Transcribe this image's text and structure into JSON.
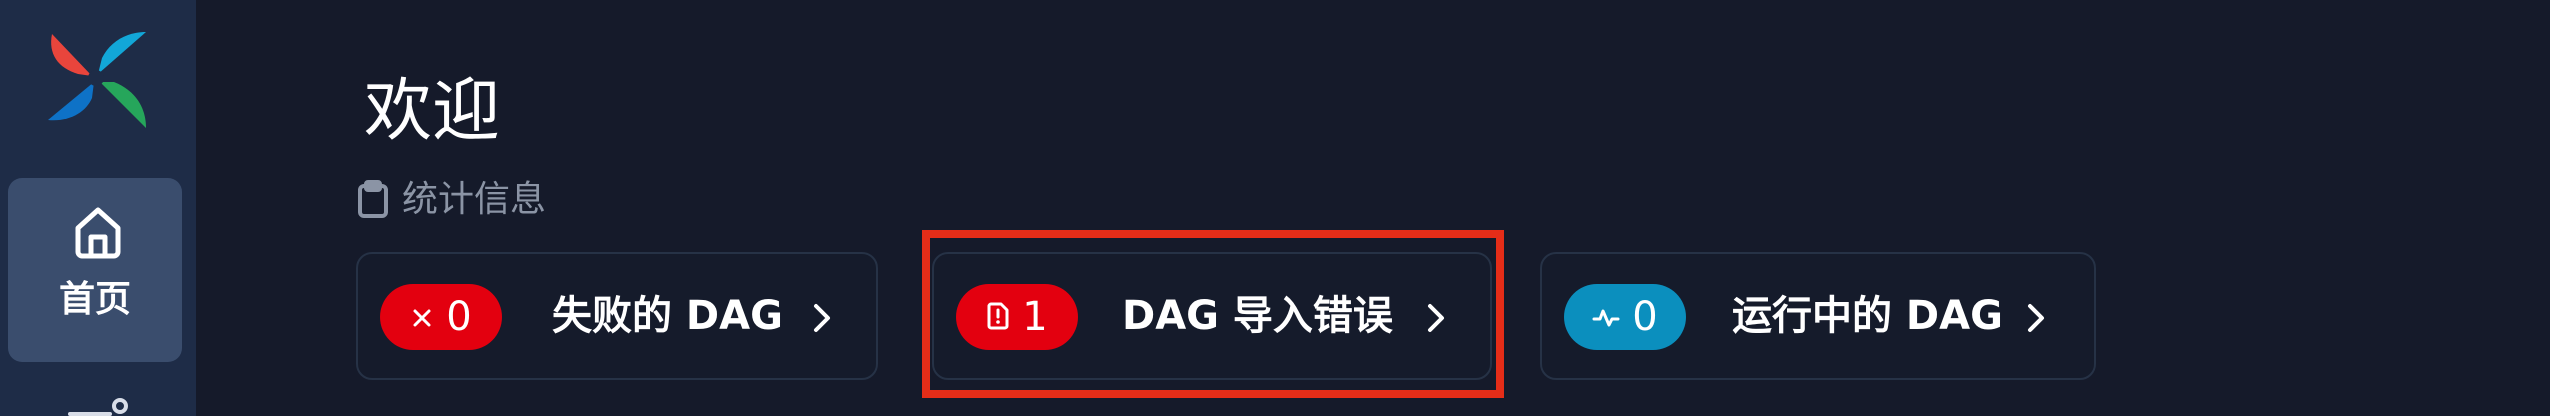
{
  "sidebar": {
    "logo_icon": "airflow-pinwheel-icon",
    "items": [
      {
        "label": "首页",
        "icon": "home-icon",
        "selected": true
      }
    ],
    "partial_item_icon": "partial-menu-icon"
  },
  "main": {
    "title": "欢迎",
    "stats_section": {
      "label": "统计信息",
      "icon": "clipboard-icon",
      "cards": [
        {
          "count": "0",
          "label": "失败的 DAG",
          "icon": "x-icon",
          "color": "#e3000f"
        },
        {
          "count": "1",
          "label": "DAG 导入错误",
          "icon": "warning-file-icon",
          "color": "#e3000f",
          "highlighted": true
        },
        {
          "count": "0",
          "label": "运行中的 DAG",
          "icon": "activity-icon",
          "color": "#0b8fbe"
        }
      ]
    }
  },
  "colors": {
    "background": "#151a2a",
    "sidebar": "#1e2c47",
    "selected_nav": "#3a4d6d",
    "danger": "#e3000f",
    "info": "#0b8fbe",
    "highlight": "#e52d18",
    "muted_text": "#8b94a5"
  }
}
